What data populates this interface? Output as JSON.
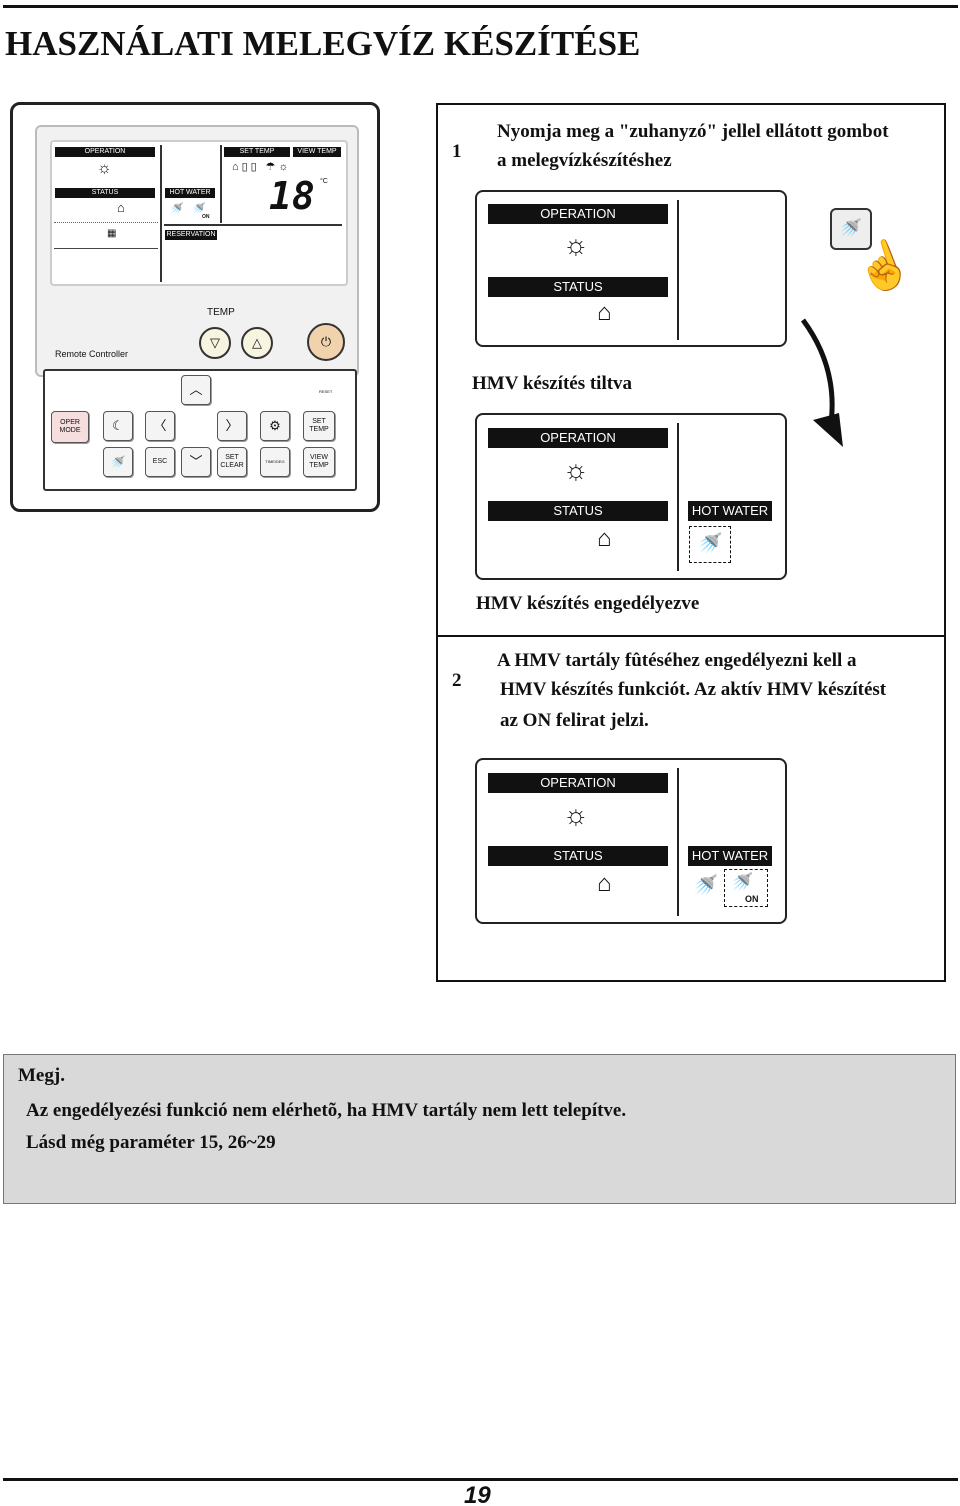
{
  "page_title": "HASZNÁLATI MELEGVÍZ KÉSZÍTÉSE",
  "remote": {
    "label": "Remote Controller",
    "lcd": {
      "operation": "OPERATION",
      "status": "STATUS",
      "hot_water": "HOT WATER",
      "set_temp": "SET TEMP",
      "view_temp": "VIEW TEMP",
      "reservation": "RESERVATION",
      "temperature": "18",
      "unit": "°C",
      "on": "ON"
    },
    "temp_label": "TEMP",
    "reset": "RESET",
    "keys": {
      "oper_mode": "OPER MODE",
      "esc": "ESC",
      "set_clear_1": "SET",
      "set_clear_2": "CLEAR",
      "time_label": "TIME/DEG",
      "set_temp": "SET TEMP",
      "view_temp": "VIEW TEMP"
    }
  },
  "step1": {
    "number": "1",
    "text_line1": "Nyomja meg a \"zuhanyzó\" jellel ellátott gombot",
    "text_line2": "a melegvízkészítéshez",
    "caption_disabled": "HMV készítés tiltva",
    "caption_enabled": "HMV készítés engedélyezve"
  },
  "step2": {
    "number": "2",
    "text_line1": "A HMV tartály fûtéséhez engedélyezni kell a",
    "text_line2": "HMV készítés funkciót. Az aktív HMV készítést",
    "text_line3": "az ON felirat jelzi."
  },
  "panel": {
    "operation": "OPERATION",
    "status": "STATUS",
    "hot_water": "HOT WATER",
    "on": "ON"
  },
  "note": {
    "title": "Megj.",
    "line1": "Az engedélyezési funkció nem elérhetõ, ha HMV tartály nem lett telepítve.",
    "line2": "Lásd még paraméter 15, 26~29"
  },
  "page_number": "19"
}
